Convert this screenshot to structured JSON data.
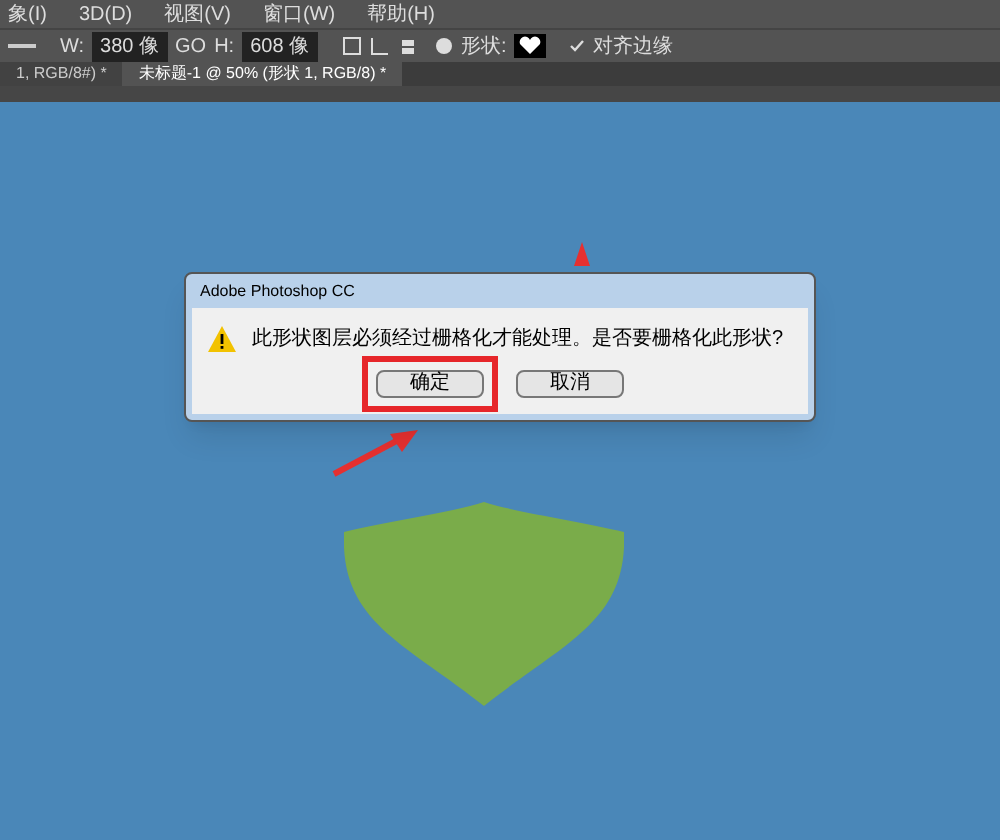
{
  "menu_bar": [
    "象(I)",
    "3D(D)",
    "视图(V)",
    "窗口(W)",
    "帮助(H)"
  ],
  "options_bar": {
    "width_label": "W:",
    "width_value": "380 像",
    "link_label": "GO",
    "height_label": "H:",
    "height_value": "608 像",
    "shape_label": "形状:",
    "align_edges": {
      "label": "对齐边缘",
      "checked": true
    }
  },
  "tabs": [
    {
      "label": "1, RGB/8#) *",
      "selected": false
    },
    {
      "label": "未标题-1 @ 50% (形状 1, RGB/8) *",
      "selected": true
    }
  ],
  "dialog": {
    "title": "Adobe Photoshop CC",
    "message": "此形状图层必须经过栅格化才能处理。是否要栅格化此形状?",
    "buttons": [
      {
        "label": "确定",
        "highlighted": true
      },
      {
        "label": "取消",
        "highlighted": false
      }
    ]
  }
}
